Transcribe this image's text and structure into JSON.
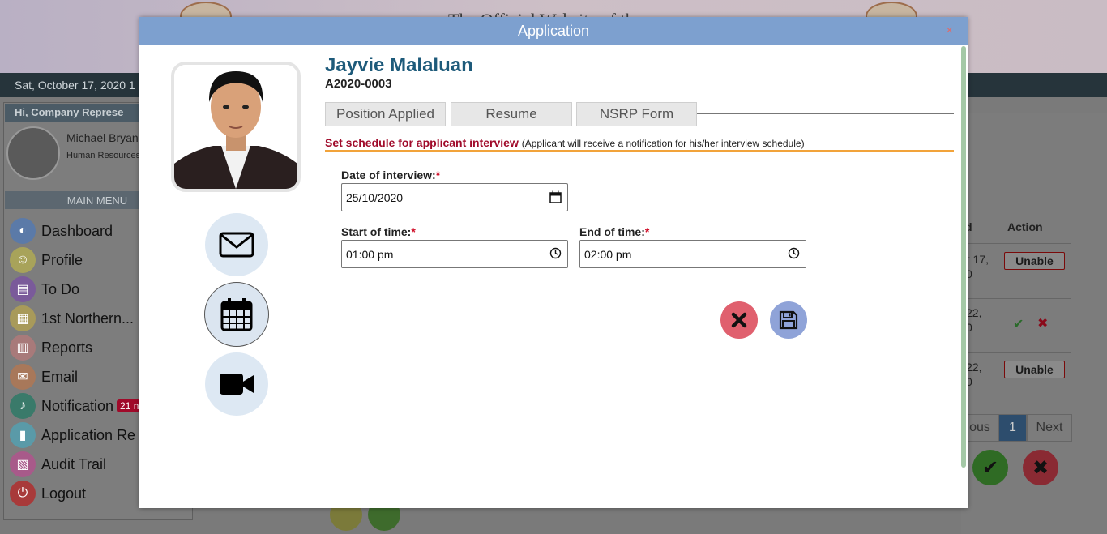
{
  "background": {
    "site_title": "The Official Website of the",
    "date_text": "Sat, October 17, 2020 1",
    "greeting": "Hi, Company Represe",
    "user_name": "Michael Bryan",
    "user_role": "Human Resources",
    "menu_header": "MAIN MENU",
    "menu_items": [
      {
        "label": "Dashboard",
        "icon": "dashboard-icon",
        "color": "#5b7aa8"
      },
      {
        "label": "Profile",
        "icon": "profile-icon",
        "color": "#a8a35a"
      },
      {
        "label": "To Do",
        "icon": "todo-icon",
        "color": "#7a5a9a"
      },
      {
        "label": "1st Northern...",
        "icon": "building-icon",
        "color": "#a89a5a"
      },
      {
        "label": "Reports",
        "icon": "reports-icon",
        "color": "#a87a7a"
      },
      {
        "label": "Email",
        "icon": "email-icon",
        "color": "#a8785a"
      },
      {
        "label": "Notification",
        "icon": "bell-icon",
        "color": "#3a7a6a"
      },
      {
        "label": "Application Re",
        "icon": "bookmark-icon",
        "color": "#5a9aa8"
      },
      {
        "label": "Audit Trail",
        "icon": "audit-icon",
        "color": "#a85a8a"
      },
      {
        "label": "Logout",
        "icon": "power-icon",
        "color": "#a83a3a"
      }
    ],
    "notification_badge": "21 n",
    "table": {
      "col_d": "d",
      "col_action": "Action",
      "rows": [
        {
          "date_frag_1": "r 17,",
          "date_frag_2": "0",
          "action": "Unable"
        },
        {
          "date_frag_1": "22,",
          "date_frag_2": "0",
          "action": "approve-reject"
        },
        {
          "date_frag_1": "22,",
          "date_frag_2": "0",
          "action": "Unable"
        }
      ],
      "pager_prev": "ous",
      "pager_current": "1",
      "pager_next": "Next"
    }
  },
  "modal": {
    "title": "Application",
    "close_label": "×",
    "applicant": {
      "name": "Jayvie Malaluan",
      "id": "A2020-0003"
    },
    "tabs": [
      "Position Applied",
      "Resume",
      "NSRP Form"
    ],
    "schedule": {
      "heading": "Set schedule for applicant interview",
      "note": "(Applicant will receive a notification for his/her interview schedule)",
      "date_label": "Date of interview:",
      "date_value": "25/10/2020",
      "start_label": "Start of time:",
      "start_value": "01:00 pm",
      "end_label": "End of time:",
      "end_value": "02:00 pm",
      "required_mark": "*"
    },
    "colors": {
      "header": "#7da0cf",
      "name": "#1d5a7a",
      "cancel": "#e0606e",
      "save": "#8fa3d8",
      "accent_line": "#f2a33a"
    }
  }
}
